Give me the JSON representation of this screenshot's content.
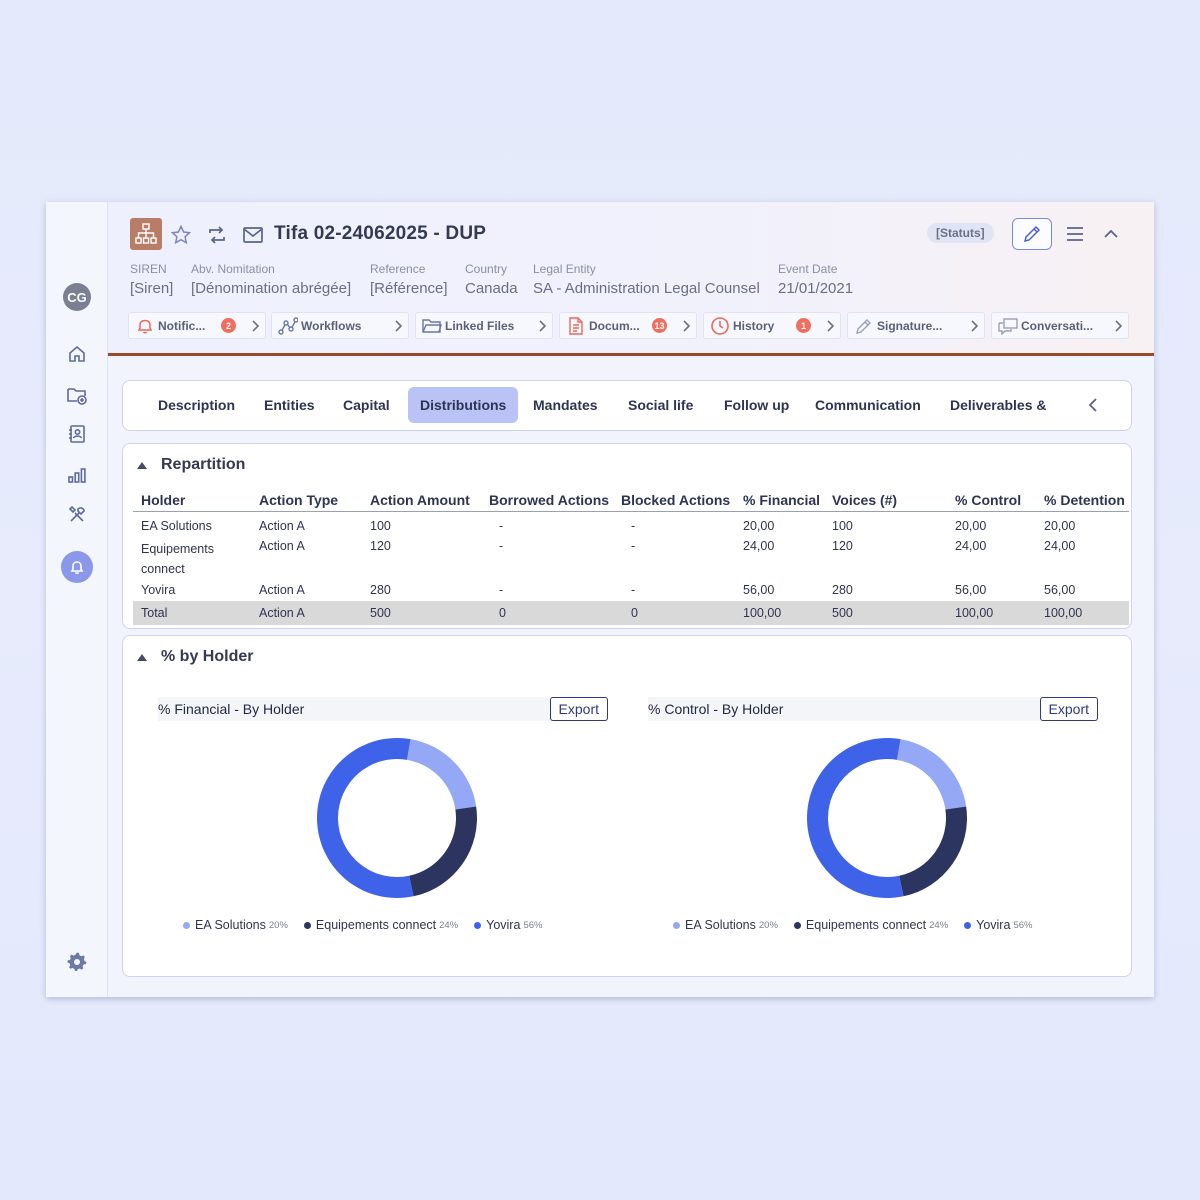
{
  "user": {
    "initials": "CG"
  },
  "sidebar": {
    "icons": [
      "home-icon",
      "folder-add-icon",
      "contacts-icon",
      "bar-chart-icon",
      "tools-icon",
      "bell-icon",
      "gear-icon"
    ]
  },
  "header": {
    "title": "Tifa 02-24062025 - DUP",
    "status_badge": "[Statuts]",
    "meta": [
      {
        "label": "SIREN",
        "value": "[Siren]"
      },
      {
        "label": "Abv. Nomitation",
        "value": "[Dénomination abrégée]"
      },
      {
        "label": "Reference",
        "value": "[Référence]"
      },
      {
        "label": "Country",
        "value": "Canada"
      },
      {
        "label": "Legal Entity",
        "value": "SA - Administration Legal Counsel"
      },
      {
        "label": "Event Date",
        "value": "21/01/2021"
      }
    ],
    "chips": [
      {
        "label": "Notific...",
        "badge": "2",
        "icon": "bell-icon"
      },
      {
        "label": "Workflows",
        "badge": null,
        "icon": "workflow-icon"
      },
      {
        "label": "Linked Files",
        "badge": null,
        "icon": "folder-icon"
      },
      {
        "label": "Docum...",
        "badge": "13",
        "icon": "document-icon"
      },
      {
        "label": "History",
        "badge": "1",
        "icon": "clock-icon"
      },
      {
        "label": "Signature...",
        "badge": null,
        "icon": "pen-icon"
      },
      {
        "label": "Conversati...",
        "badge": null,
        "icon": "chat-icon"
      }
    ]
  },
  "tabs": [
    "Description",
    "Entities",
    "Capital",
    "Distributions",
    "Mandates",
    "Social  life",
    "Follow up",
    "Communication",
    "Deliverables &"
  ],
  "active_tab": "Distributions",
  "repartition": {
    "title": "Repartition",
    "columns": [
      "Holder",
      "Action Type",
      "Action Amount",
      "Borrowed Actions",
      "Blocked Actions",
      "% Financial",
      "Voices (#)",
      "% Control",
      "% Detention"
    ],
    "rows": [
      [
        "EA Solutions",
        "Action A",
        "100",
        "-",
        "-",
        "20,00",
        "100",
        "20,00",
        "20,00"
      ],
      [
        "Equipements connect",
        "Action A",
        "120",
        "-",
        "-",
        "24,00",
        "120",
        "24,00",
        "24,00"
      ],
      [
        "Yovira",
        "Action A",
        "280",
        "-",
        "-",
        "56,00",
        "280",
        "56,00",
        "56,00"
      ]
    ],
    "total": [
      "Total",
      "Action A",
      "500",
      "0",
      "0",
      "100,00",
      "500",
      "100,00",
      "100,00"
    ]
  },
  "by_holder": {
    "title": "% by Holder",
    "export_label": "Export"
  },
  "chart_data": [
    {
      "type": "pie",
      "title": "% Financial - By Holder",
      "categories": [
        "EA Solutions",
        "Equipements connect",
        "Yovira"
      ],
      "values": [
        20,
        24,
        56
      ],
      "value_labels": [
        "20%",
        "24%",
        "56%"
      ],
      "colors": [
        "#94a8f5",
        "#2c3560",
        "#3f63e8"
      ],
      "legend": "bottom"
    },
    {
      "type": "pie",
      "title": "% Control - By Holder",
      "categories": [
        "EA Solutions",
        "Equipements connect",
        "Yovira"
      ],
      "values": [
        20,
        24,
        56
      ],
      "value_labels": [
        "20%",
        "24%",
        "56%"
      ],
      "colors": [
        "#94a8f5",
        "#2c3560",
        "#3f63e8"
      ],
      "legend": "bottom"
    }
  ]
}
